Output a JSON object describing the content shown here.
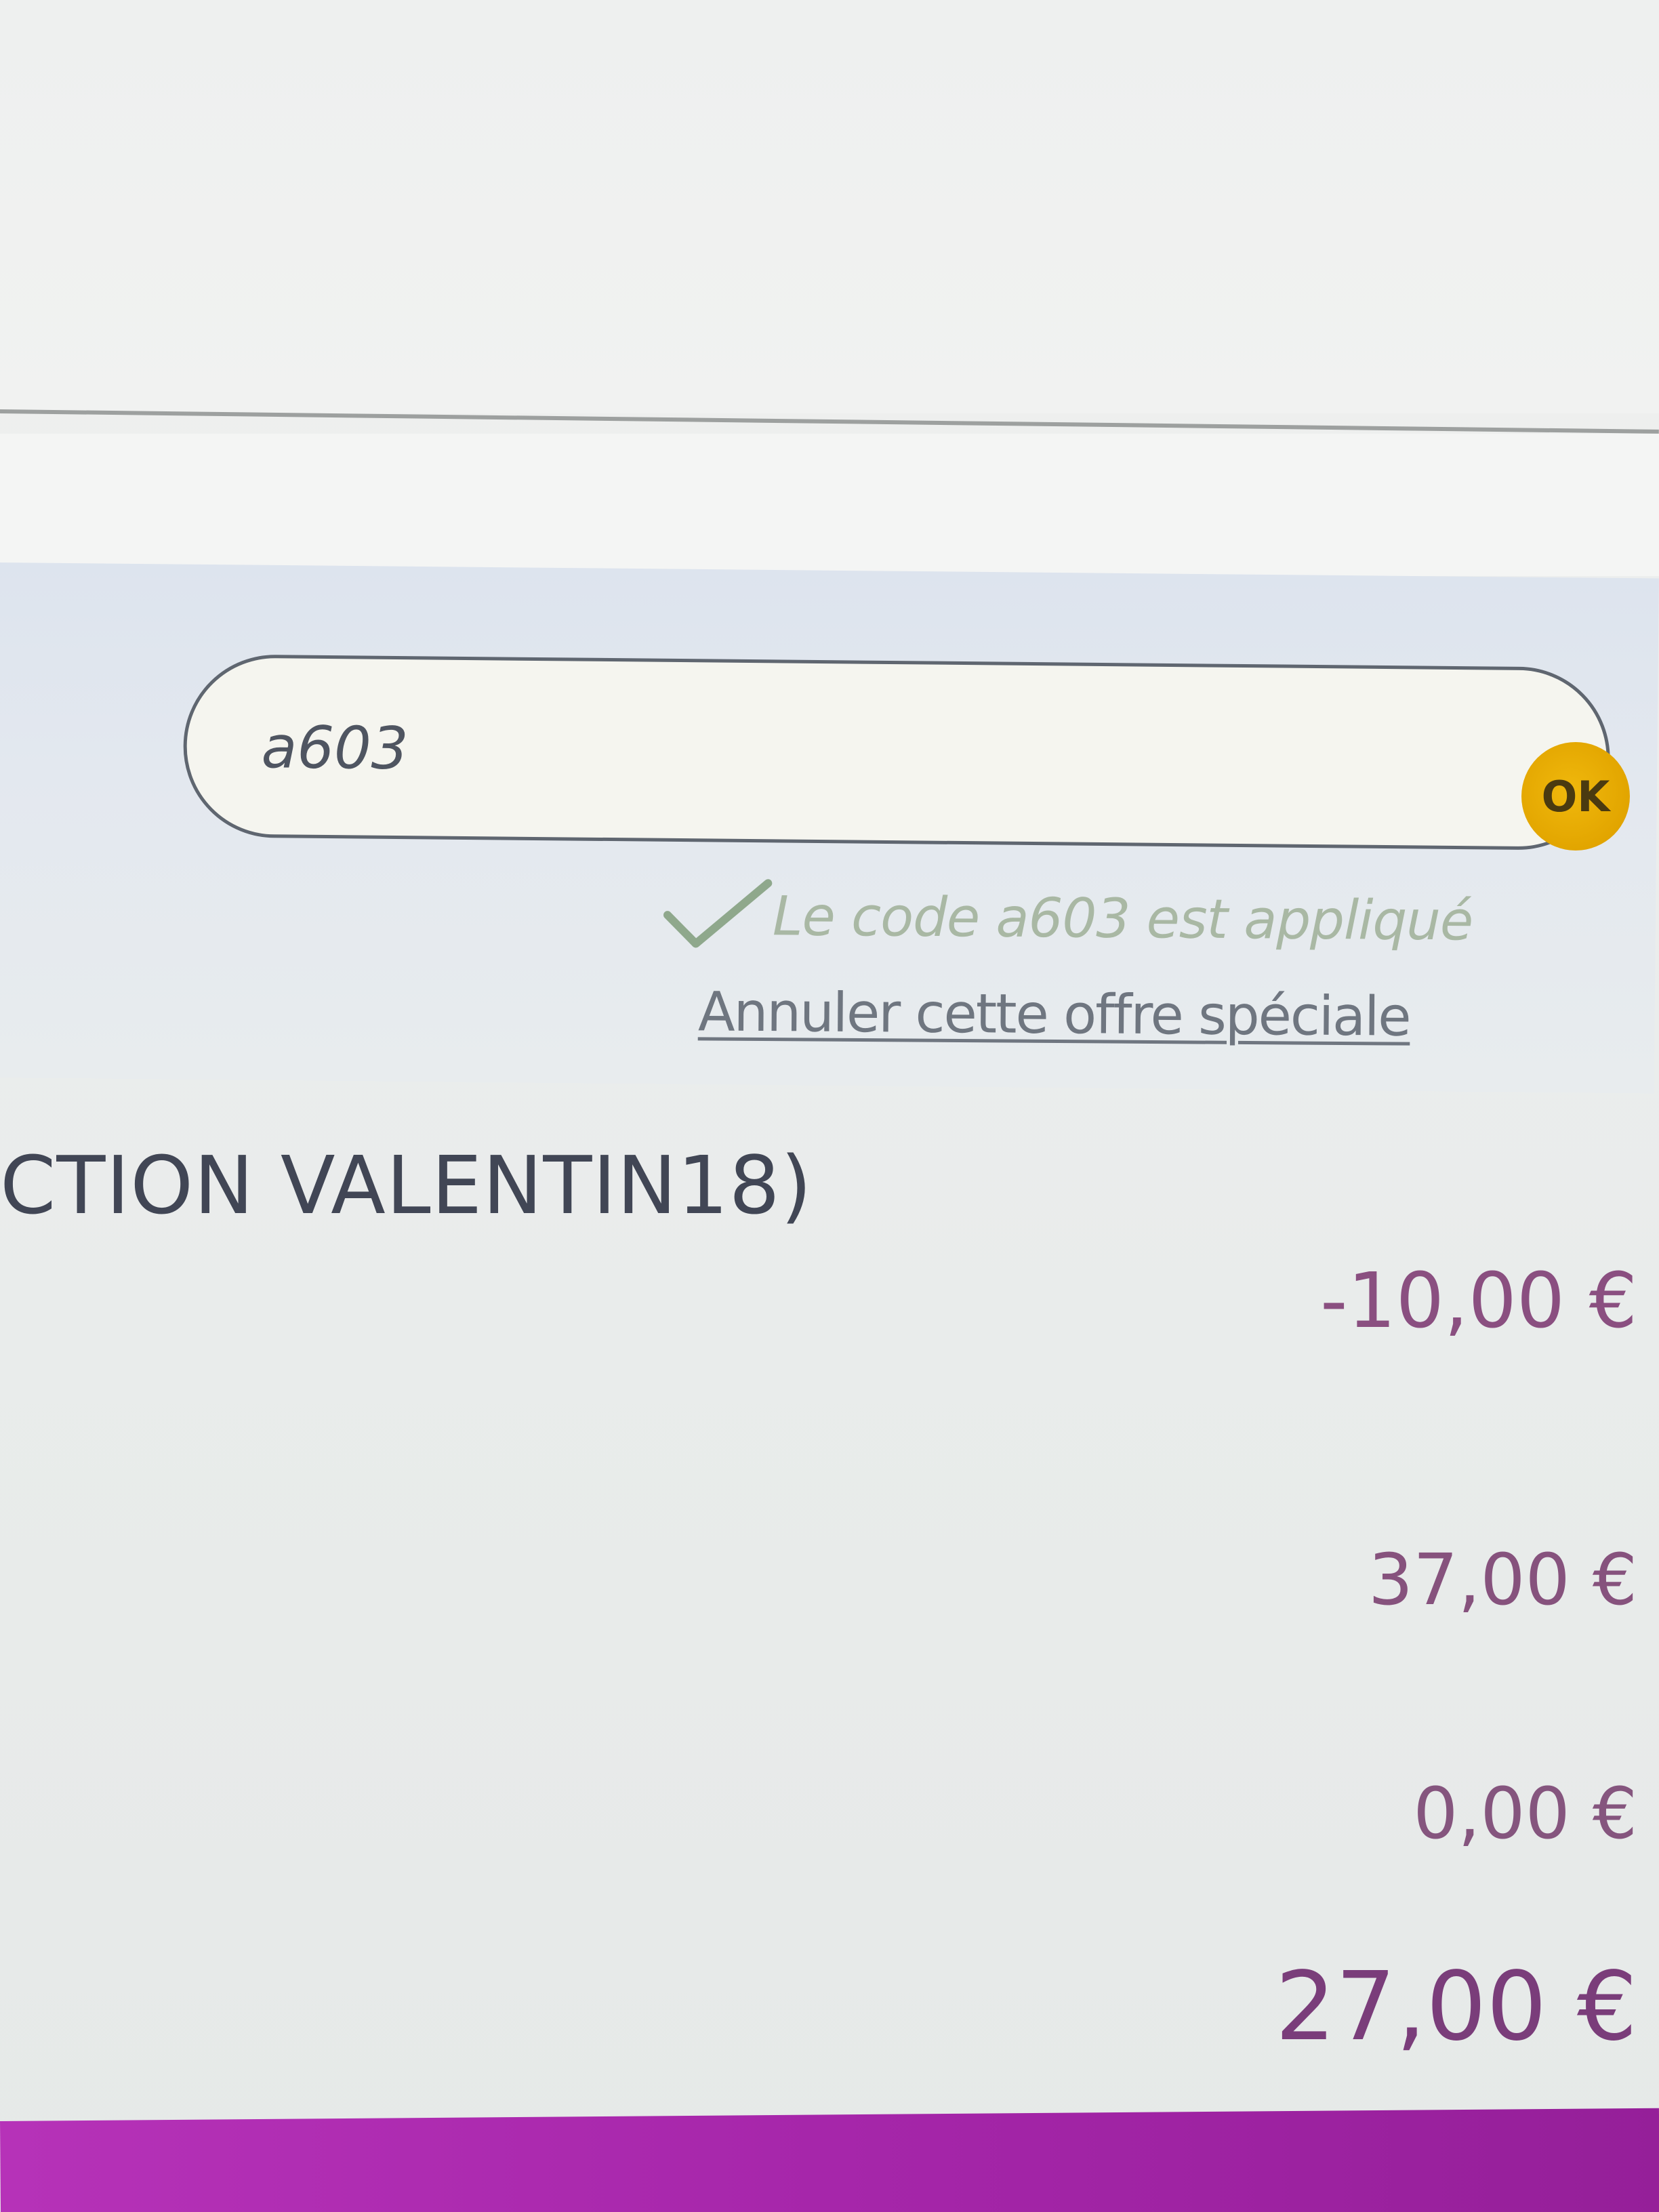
{
  "promo": {
    "input_value": "a603",
    "ok_label": "OK",
    "success_message": "Le code a603 est appliqué",
    "cancel_link": "Annuler cette offre spéciale"
  },
  "summary": {
    "promo_title": "CTION VALENTIN18)",
    "discount": "-10,00 €",
    "subtotal": "37,00 €",
    "shipping": "0,00 €",
    "total": "27,00 €"
  },
  "colors": {
    "ok_button": "#e2a500",
    "success_text": "#a9b8a4",
    "price_text": "#7a4a7c",
    "checkout_bar": "#a626aa"
  }
}
